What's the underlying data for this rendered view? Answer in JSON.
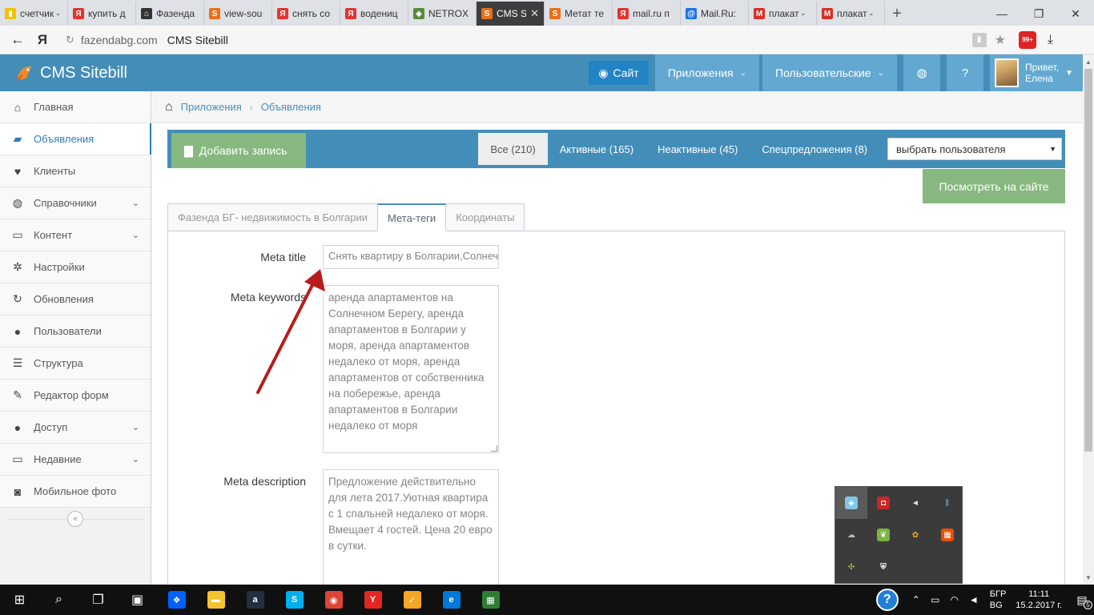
{
  "browser": {
    "tabs": [
      {
        "label": "счетчик -",
        "fav_color": "#f2c200",
        "fav_glyph": "▮"
      },
      {
        "label": "купить д",
        "fav_color": "#e3342f",
        "fav_glyph": "Я"
      },
      {
        "label": "Фазенда",
        "fav_color": "#333333",
        "fav_glyph": "⌂"
      },
      {
        "label": "view-sou",
        "fav_color": "#e8711c",
        "fav_glyph": "S"
      },
      {
        "label": "снять со",
        "fav_color": "#e3342f",
        "fav_glyph": "Я"
      },
      {
        "label": "водениц",
        "fav_color": "#e3342f",
        "fav_glyph": "Я"
      },
      {
        "label": "NETROX",
        "fav_color": "#5b8a3a",
        "fav_glyph": "◆"
      },
      {
        "label": "CMS S",
        "fav_color": "#e8711c",
        "fav_glyph": "S",
        "active": true
      },
      {
        "label": "Метат те",
        "fav_color": "#e8711c",
        "fav_glyph": "S"
      },
      {
        "label": "mail.ru п",
        "fav_color": "#e3342f",
        "fav_glyph": "Я"
      },
      {
        "label": "Mail.Ru:",
        "fav_color": "#1a73e8",
        "fav_glyph": "@"
      },
      {
        "label": "плакат -",
        "fav_color": "#d93025",
        "fav_glyph": "M"
      },
      {
        "label": "плакат -",
        "fav_color": "#d93025",
        "fav_glyph": "M"
      }
    ],
    "new_tab": "+",
    "address": {
      "domain": "fazendabg.com",
      "title": "CMS Sitebill",
      "badge_text": "99+"
    }
  },
  "navbar": {
    "brand": "CMS Sitebill",
    "site_button": "Сайт",
    "apps_dropdown": "Приложения",
    "user_dropdown": "Пользовательские",
    "greeting": "Привет,",
    "user_name": "Елена"
  },
  "sidebar": {
    "items": [
      {
        "label": "Главная",
        "icon": "home-icon",
        "glyph": "⌂"
      },
      {
        "label": "Объявления",
        "icon": "book-icon",
        "glyph": "▰",
        "active": true
      },
      {
        "label": "Клиенты",
        "icon": "heart-icon",
        "glyph": "♥"
      },
      {
        "label": "Справочники",
        "icon": "globe-icon",
        "glyph": "◍",
        "chevron": true
      },
      {
        "label": "Контент",
        "icon": "laptop-icon",
        "glyph": "▭",
        "chevron": true
      },
      {
        "label": "Настройки",
        "icon": "cog-icon",
        "glyph": "✲"
      },
      {
        "label": "Обновления",
        "icon": "refresh-icon",
        "glyph": "↻"
      },
      {
        "label": "Пользователи",
        "icon": "user-icon",
        "glyph": "●"
      },
      {
        "label": "Структура",
        "icon": "list-icon",
        "glyph": "☰"
      },
      {
        "label": "Редактор форм",
        "icon": "edit-icon",
        "glyph": "✎"
      },
      {
        "label": "Доступ",
        "icon": "users-icon",
        "glyph": "●",
        "chevron": true
      },
      {
        "label": "Недавние",
        "icon": "desktop-icon",
        "glyph": "▭",
        "chevron": true
      },
      {
        "label": "Мобильное фото",
        "icon": "camera-icon",
        "glyph": "◙"
      }
    ]
  },
  "breadcrumbs": {
    "items": [
      "Приложения",
      "Объявления"
    ]
  },
  "actions": {
    "add_record": "Добавить запись",
    "filters": [
      {
        "label": "Все (210)",
        "active": true
      },
      {
        "label": "Активные (165)"
      },
      {
        "label": "Неактивные (45)"
      },
      {
        "label": "Спецпредложения (8)"
      }
    ],
    "user_select": "выбрать пользователя",
    "view_on_site": "Посмотреть на сайте"
  },
  "form": {
    "tabs": [
      {
        "label": "Фазенда БГ- недвижимость в Болгарии"
      },
      {
        "label": "Мета-теги",
        "active": true
      },
      {
        "label": "Координаты"
      }
    ],
    "meta_title_label": "Meta title",
    "meta_title_value": "Снять квартиру в Болгарии,Солнечный Берег",
    "meta_keywords_label": "Meta keywords",
    "meta_keywords_value": "аренда апартаментов на Солнечном Берегу, аренда апартаментов в Болгарии у моря, аренда апартаментов недалеко от моря, аренда апартаментов от собственника на побережье, аренда апартаментов в Болгарии недалеко от моря",
    "meta_description_label": "Meta description",
    "meta_description_value": "Предложение действительно для лета 2017.Уютная квартира с 1 спальней недалеко от моря. Вмещает 4 гостей. Цена 20 евро в сутки."
  },
  "taskbar": {
    "apps": [
      {
        "name": "dropbox-icon",
        "color": "#0061fe",
        "glyph": "❖"
      },
      {
        "name": "file-explorer-icon",
        "color": "#f4c430",
        "glyph": "▬"
      },
      {
        "name": "amazon-icon",
        "color": "#232f3e",
        "glyph": "a"
      },
      {
        "name": "skype-icon",
        "color": "#00aff0",
        "glyph": "S"
      },
      {
        "name": "chrome-icon",
        "color": "#db4437",
        "glyph": "◉"
      },
      {
        "name": "yandex-browser-icon",
        "color": "#e52620",
        "glyph": "Y"
      },
      {
        "name": "tasks-icon",
        "color": "#f5a623",
        "glyph": "✓"
      },
      {
        "name": "edge-icon",
        "color": "#0078d7",
        "glyph": "e"
      },
      {
        "name": "app-tiles-icon",
        "color": "#2e7d32",
        "glyph": "▦"
      }
    ],
    "lang_top": "БГР",
    "lang_bottom": "BG",
    "time": "11:11",
    "date": "15.2.2017 г.",
    "notif_count": "5"
  }
}
